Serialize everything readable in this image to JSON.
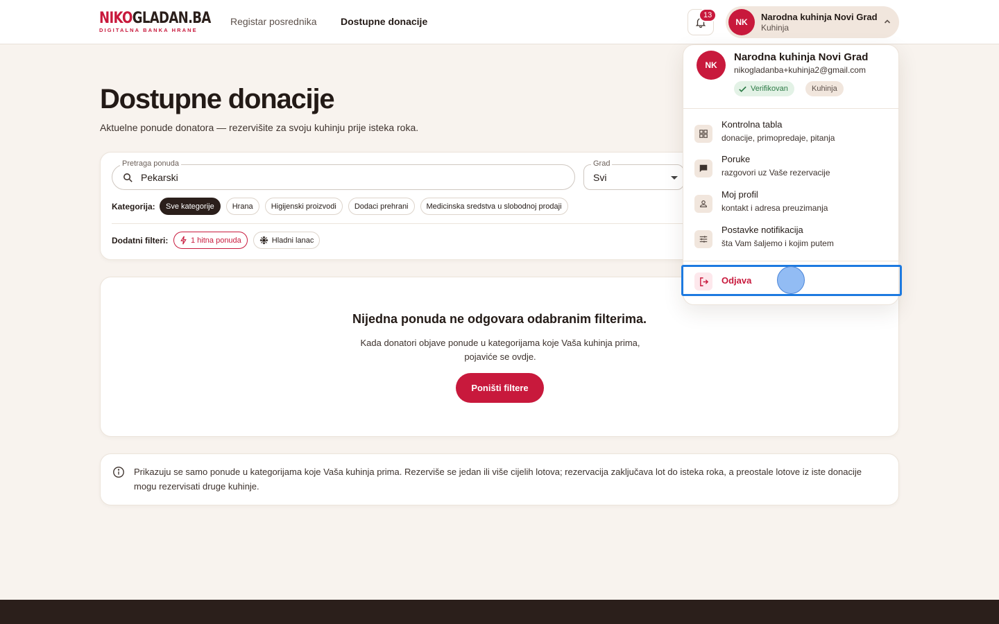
{
  "header": {
    "logo": {
      "part1": "NIKO",
      "part2": "GLADAN.BA",
      "tagline": "DIGITALNA BANKA HRANE"
    },
    "nav": [
      {
        "label": "Registar posrednika"
      },
      {
        "label": "Dostupne donacije"
      }
    ],
    "notifications_count": "13",
    "user": {
      "initials": "NK",
      "name": "Narodna kuhinja Novi Grad",
      "role": "Kuhinja"
    }
  },
  "page": {
    "title": "Dostupne donacije",
    "subtitle": "Aktuelne ponude donatora — rezervišite za svoju kuhinju prije isteka roka."
  },
  "filters": {
    "search_label": "Pretraga ponuda",
    "search_value": "Pekarski",
    "city_label": "Grad",
    "city_value": "Svi",
    "category_label": "Kategorija:",
    "categories": [
      {
        "label": "Sve kategorije"
      },
      {
        "label": "Hrana"
      },
      {
        "label": "Higijenski proizvodi"
      },
      {
        "label": "Dodaci prehrani"
      },
      {
        "label": "Medicinska sredstva u slobodnoj prodaji"
      }
    ],
    "extra_label": "Dodatni filteri:",
    "extra": {
      "urgent": "1 hitna ponuda",
      "cold": "Hladni lanac"
    }
  },
  "empty": {
    "title": "Nijedna ponuda ne odgovara odabranim filterima.",
    "text": "Kada donatori objave ponude u kategorijama koje Vaša kuhinja prima, pojaviće se ovdje.",
    "reset": "Poništi filtere"
  },
  "info": {
    "text": "Prikazuju se samo ponude u kategorijama koje Vaša kuhinja prima. Rezerviše se jedan ili više cijelih lotova; rezervacija zaključava lot do isteka roka, a preostale lotove iz iste donacije mogu rezervisati druge kuhinje."
  },
  "menu": {
    "initials": "NK",
    "name": "Narodna kuhinja Novi Grad",
    "email": "nikogladanba+kuhinja2@gmail.com",
    "verified": "Verifikovan",
    "role": "Kuhinja",
    "items": [
      {
        "title": "Kontrolna tabla",
        "sub": "donacije, primopredaje, pitanja"
      },
      {
        "title": "Poruke",
        "sub": "razgovori uz Vaše rezervacije"
      },
      {
        "title": "Moj profil",
        "sub": "kontakt i adresa preuzimanja"
      },
      {
        "title": "Postavke notifikacija",
        "sub": "šta Vam šaljemo i kojim putem"
      }
    ],
    "logout": "Odjava"
  },
  "colors": {
    "accent": "#c8193c",
    "dark": "#2b1f1b",
    "background": "#f8f3ee",
    "highlight": "#1d7ae0"
  }
}
